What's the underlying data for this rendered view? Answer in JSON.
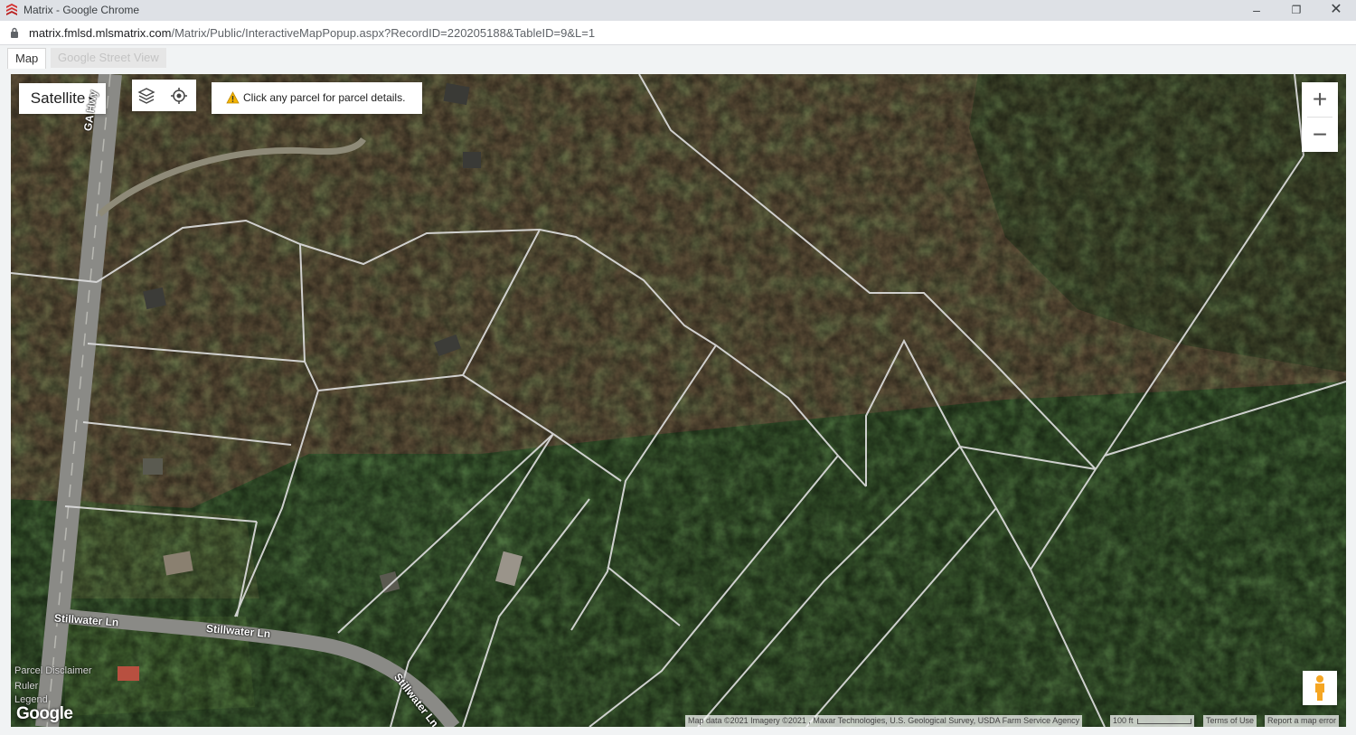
{
  "window": {
    "title": "Matrix - Google Chrome",
    "minimize": "–",
    "maximize": "❐",
    "close": "✕"
  },
  "address_bar": {
    "url_host": "matrix.fmlsd.mlsmatrix.com",
    "url_path": "/Matrix/Public/InteractiveMapPopup.aspx?RecordID=220205188&TableID=9&L=1"
  },
  "tabs": [
    {
      "label": "Map",
      "active": true
    },
    {
      "label": "Google Street View",
      "active": false
    }
  ],
  "map": {
    "map_type": "Satellite",
    "notice": "Click any parcel for parcel details.",
    "zoom_in": "+",
    "zoom_out": "−",
    "streets": [
      "GA Hwy",
      "Stillwater Ln",
      "Stillwater Ln",
      "Stillwater Ln"
    ],
    "side_links": [
      "Parcel Disclaimer",
      "Ruler",
      "Legend"
    ],
    "logo": "Google",
    "attribution": {
      "map_data": "Map data ©2021 Imagery ©2021 , Maxar Technologies, U.S. Geological Survey, USDA Farm Service Agency",
      "scale": "100 ft",
      "terms": "Terms of Use",
      "report": "Report a map error"
    },
    "colors": {
      "forest": "#2f4a26",
      "brush": "#5c4e36",
      "parcel_line": "#dcdcdc"
    },
    "icons": [
      "layers-icon",
      "locate-icon",
      "warning-icon",
      "pegman-icon",
      "lock-icon"
    ]
  }
}
